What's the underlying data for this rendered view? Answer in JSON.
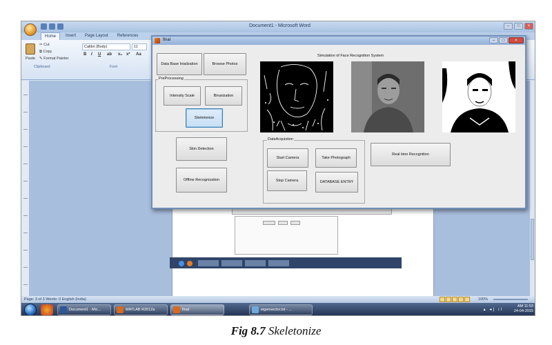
{
  "word": {
    "title": "Document1 - Microsoft Word",
    "tabs": [
      "Home",
      "Insert",
      "Page Layout",
      "References"
    ],
    "active_tab": "Home",
    "clipboard": {
      "paste": "Paste",
      "cut": "Cut",
      "copy": "Copy",
      "format_painter": "Format Painter",
      "group": "Clipboard"
    },
    "font": {
      "name": "Calibri (Body)",
      "size": "11",
      "group": "Font"
    },
    "status": "Page: 3 of 3   Words: 0   English (India)",
    "zoom": "100%"
  },
  "taskbar": {
    "apps": [
      {
        "label": "Document1 - Mic...",
        "icon": "word-icon",
        "color": "#2b5797"
      },
      {
        "label": "MATLAB R2012a",
        "icon": "matlab-icon",
        "color": "#d9691f"
      },
      {
        "label": "final",
        "icon": "figure-icon",
        "color": "#d9691f"
      },
      {
        "label": "eigenvector.txt - ...",
        "icon": "notepad-icon",
        "color": "#6fa8dc"
      }
    ],
    "time": "AM 11:53",
    "date": "24-04-2015"
  },
  "figure": {
    "title": "final",
    "simulation_title": "Simulation of Face Recognition System",
    "buttons": {
      "db_init": "Data Base Inialization",
      "browse": "Browse Photos",
      "intensity": "Intensity Scale",
      "binarization": "Binarization",
      "skeletonize": "Skeletonize",
      "skin": "Skin Detection",
      "offline": "Offline Recognization",
      "start_camera": "Start Camera",
      "take_photo": "Take Photograph",
      "stop_camera": "Stop Camera",
      "db_entry": "DATABASE ENTRY",
      "realtime": "Real time Recognition"
    },
    "panels": {
      "preprocessing": "PreProcessing",
      "data_acquisition": "DataAcquistion"
    },
    "images": [
      "skeleton-edge-image",
      "grayscale-face-image",
      "binary-face-image"
    ]
  },
  "caption": {
    "bold": "Fig 8.7",
    "italic": "Skeletonize"
  }
}
